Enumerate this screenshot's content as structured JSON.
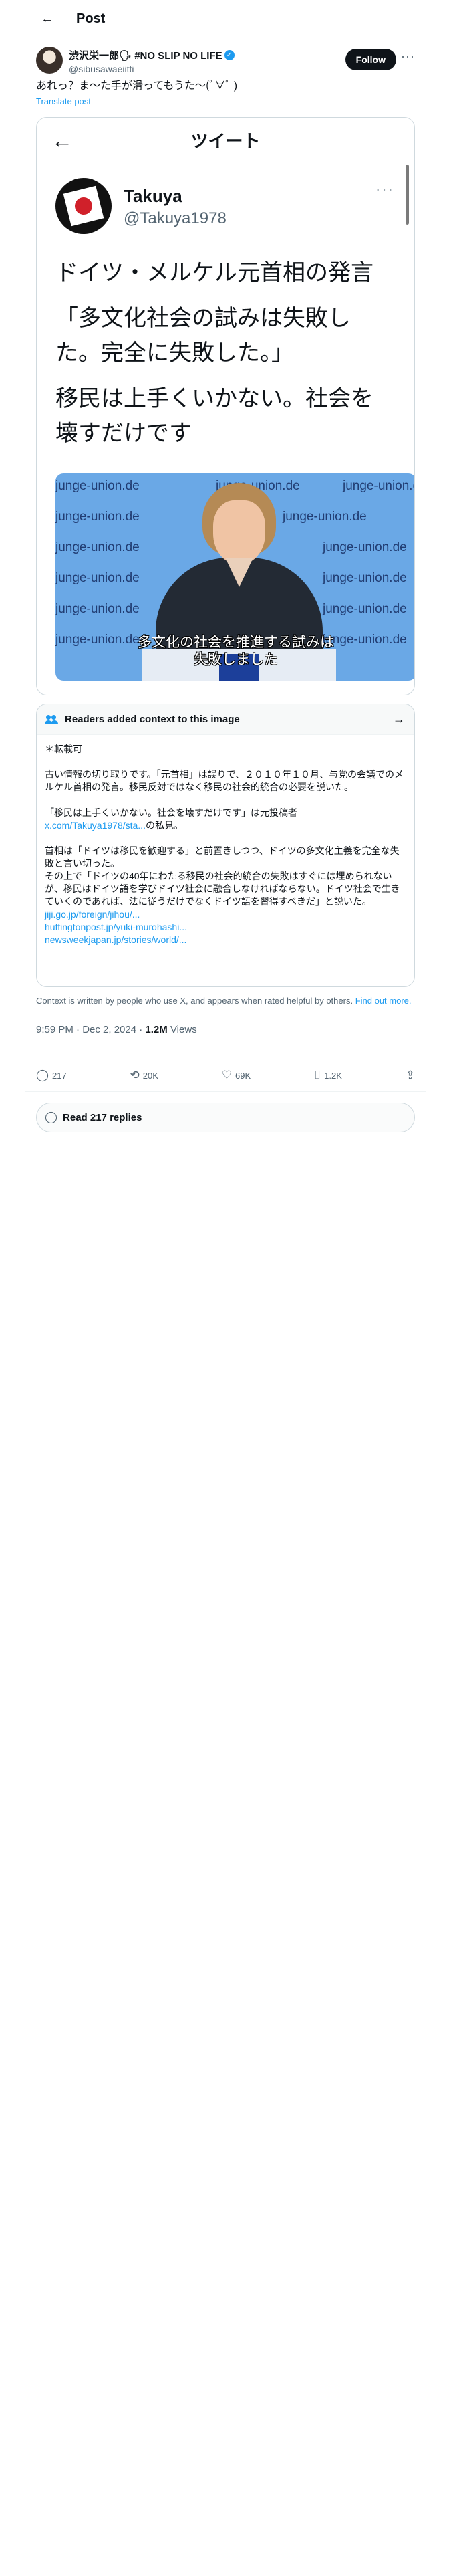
{
  "header": {
    "title": "Post"
  },
  "author": {
    "name": "渋沢栄一郎🗣 #NO SLIP NO LIFE",
    "handle": "@sibusawaeiitti",
    "follow_label": "Follow"
  },
  "post": {
    "text": "あれっ？ま〜た手が滑ってもうた〜(ﾟ∀ﾟ )",
    "translate_label": "Translate post"
  },
  "embedded": {
    "title": "ツイート",
    "user_name": "Takuya",
    "user_handle": "@Takuya1978",
    "paragraphs": [
      "ドイツ・メルケル元首相の発言",
      "「多文化社会の試みは失敗した。完全に失敗した。」",
      "移民は上手くいかない。社会を壊すだけです"
    ],
    "watermark": "junge-union.de",
    "subtitle_line1": "多文化の社会を推進する試みは",
    "subtitle_line2": "失敗しました"
  },
  "community_note": {
    "header": "Readers added context to this image",
    "lines": [
      "＊転載可",
      "",
      "古い情報の切り取りです。「元首相」は誤りで、２０１０年１０月、与党の会議でのメルケル首相の発言。移民反対ではなく移民の社会的統合の必要を説いた。",
      "",
      "「移民は上手くいかない。社会を壊すだけです」は元投稿者",
      "",
      "首相は「ドイツは移民を歓迎する」と前置きしつつ、ドイツの多文化主義を完全な失敗と言い切った。",
      "その上で「ドイツの40年にわたる移民の社会的統合の失敗はすぐには埋められないが、移民はドイツ語を学びドイツ社会に融合しなければならない。ドイツ社会で生きていくのであれば、法に従うだけでなくドイツ語を習得すべきだ」と説いた。"
    ],
    "source_link": "x.com/Takuya1978/sta...",
    "source_suffix": "の私見。",
    "links": [
      "jiji.go.jp/foreign/jihou/...",
      "huffingtonpost.jp/yuki-murohashi...",
      "newsweekjapan.jp/stories/world/..."
    ]
  },
  "disclaimer": {
    "text": "Context is written by people who use X, and appears when rated helpful by others.",
    "link": "Find out more."
  },
  "meta": {
    "timestamp": "9:59 PM · Dec 2, 2024 · ",
    "views_count": "1.2M",
    "views_label": " Views"
  },
  "actions": {
    "replies": "217",
    "reposts": "20K",
    "likes": "69K",
    "bookmarks": "1.2K"
  },
  "read_replies": {
    "label": "Read 217 replies"
  },
  "icons": {
    "back": "←",
    "more": "···",
    "verified": "✓",
    "arrow_right": "→",
    "reply": "💬",
    "repost": "⟲",
    "like": "♡",
    "bookmark": "🔖",
    "share": "⇪"
  }
}
